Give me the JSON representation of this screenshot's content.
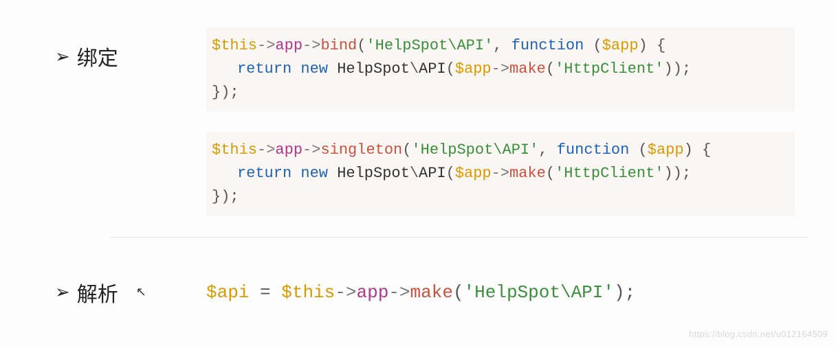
{
  "sections": {
    "bind": {
      "bullet": "➢",
      "label": "绑定"
    },
    "resolve": {
      "bullet": "➢",
      "label": "解析",
      "cursor": "↖"
    }
  },
  "tok": {
    "this": "$this",
    "app_var": "$app",
    "api_var": "$api",
    "arrow": "->",
    "backslash": "\\",
    "app": "app",
    "bind": "bind",
    "singleton": "singleton",
    "make": "make",
    "function": "function",
    "return": "return",
    "new": "new",
    "HelpSpot": "HelpSpot",
    "API": "API",
    "HttpClient": "'HttpClient'",
    "HelpSpotAPI_str": "'HelpSpot\\API'",
    "lparen": "(",
    "rparen": ")",
    "lbrace": "{",
    "rbrace": "}",
    "comma": ",",
    "semi": ";",
    "space": " ",
    "eq": "=",
    "close_paren_semi": ");",
    "close_paren_paren_semi": "));",
    "close_brace_paren_semi": "});"
  },
  "watermark": "https://blog.csdn.net/u012164509"
}
